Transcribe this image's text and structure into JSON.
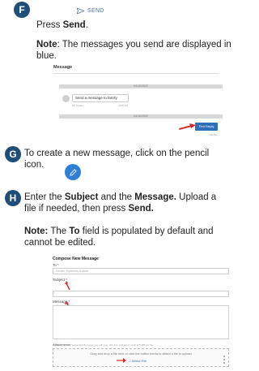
{
  "steps": {
    "f": {
      "badge": "F",
      "send_mini_label": "SEND",
      "line1_pre": "Press ",
      "line1_bold": "Send",
      "line1_post": ".",
      "note_bold": "Note",
      "note_text_1": ": The messages you send are displayed in",
      "note_text_2": "blue."
    },
    "g": {
      "badge": "G",
      "line1": "To create a new message, click on the pencil",
      "line2": "icon."
    },
    "h": {
      "badge": "H",
      "line1_pre": "Enter the ",
      "line1_bold1": "Subject",
      "line1_mid": " and the ",
      "line1_bold2": "Message.",
      "line1_post": " Upload a",
      "line2_pre": "file if needed, then press ",
      "line2_bold": "Send.",
      "note_bold1": "Note:",
      "note_pre": " The ",
      "note_bold2": "To",
      "note_post": " field is populated by default and",
      "note_line2": "cannot be edited."
    }
  },
  "message_screenshot": {
    "title": "Message",
    "date1": "04/15/2022",
    "bubble_text": "Send a message to family",
    "meta_left": "ES System",
    "meta_right": "8:16 AM",
    "date2": "04/16/2022",
    "reply_button": "Text Reply",
    "reply_meta": "7:16 AM"
  },
  "compose_screenshot": {
    "title": "Compose New Message",
    "to_label": "To",
    "to_value": "Kinder Systems Admin",
    "subject_label": "Subject",
    "message_label": "Message",
    "attachments_label": "Attachments",
    "attachments_hint": "Supported file types: jpg, pdf, png, rtst, doc, and docx | Limit of 5 MB per file",
    "drop_text": "Drag and drop a file here or click the button below to attach a file to upload",
    "select_file": "Select File",
    "required_mark": "*"
  },
  "colors": {
    "badge": "#1f4e79",
    "accent_blue": "#2f6fb7",
    "arrow_red": "#d62828",
    "pencil_bg": "#2f7fd8"
  },
  "icons": {
    "send": "paper-plane-icon",
    "pencil": "pencil-icon",
    "upload": "upload-icon",
    "arrow": "red-arrow-icon"
  }
}
